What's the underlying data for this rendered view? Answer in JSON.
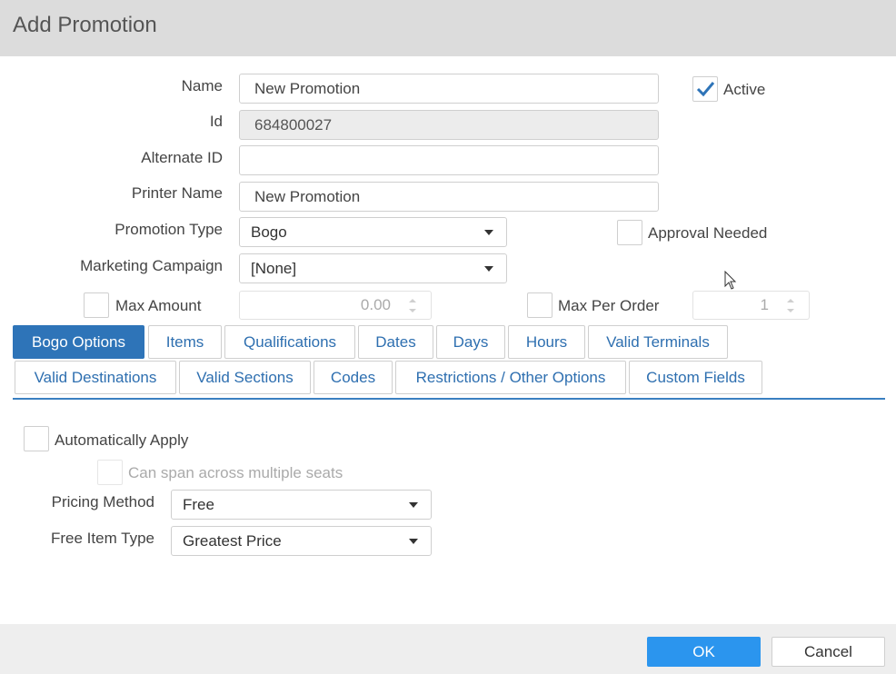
{
  "dialog": {
    "title": "Add Promotion"
  },
  "form": {
    "name": {
      "label": "Name",
      "value": "New Promotion"
    },
    "id": {
      "label": "Id",
      "value": "684800027"
    },
    "alternate_id": {
      "label": "Alternate ID",
      "value": ""
    },
    "printer_name": {
      "label": "Printer Name",
      "value": "New Promotion"
    },
    "promotion_type": {
      "label": "Promotion Type",
      "value": "Bogo"
    },
    "marketing_campaign": {
      "label": "Marketing Campaign",
      "value": "[None]"
    },
    "active": {
      "label": "Active",
      "checked": true
    },
    "approval_needed": {
      "label": "Approval Needed",
      "checked": false
    },
    "max_amount": {
      "label": "Max Amount",
      "value": "0.00",
      "checked": false
    },
    "max_per_order": {
      "label": "Max Per Order",
      "value": "1",
      "checked": false
    }
  },
  "tabs": [
    {
      "label": "Bogo Options",
      "active": true
    },
    {
      "label": "Items"
    },
    {
      "label": "Qualifications"
    },
    {
      "label": "Dates"
    },
    {
      "label": "Days"
    },
    {
      "label": "Hours"
    },
    {
      "label": "Valid Terminals"
    },
    {
      "label": "Valid Destinations"
    },
    {
      "label": "Valid Sections"
    },
    {
      "label": "Codes"
    },
    {
      "label": "Restrictions / Other Options"
    },
    {
      "label": "Custom Fields"
    }
  ],
  "bogo": {
    "automatically_apply": {
      "label": "Automatically Apply",
      "checked": false
    },
    "span_seats": {
      "label": "Can span across multiple seats",
      "checked": false
    },
    "pricing_method": {
      "label": "Pricing Method",
      "value": "Free"
    },
    "free_item_type": {
      "label": "Free Item Type",
      "value": "Greatest Price"
    }
  },
  "footer": {
    "ok_label": "OK",
    "cancel_label": "Cancel"
  },
  "colors": {
    "accent": "#2e74b8",
    "ok_button": "#2b95ee",
    "titlebar": "#dcdcdc"
  },
  "icons": {
    "check": "checkmark-icon",
    "dropdown": "chevron-down-icon",
    "cursor": "mouse-pointer-icon"
  }
}
